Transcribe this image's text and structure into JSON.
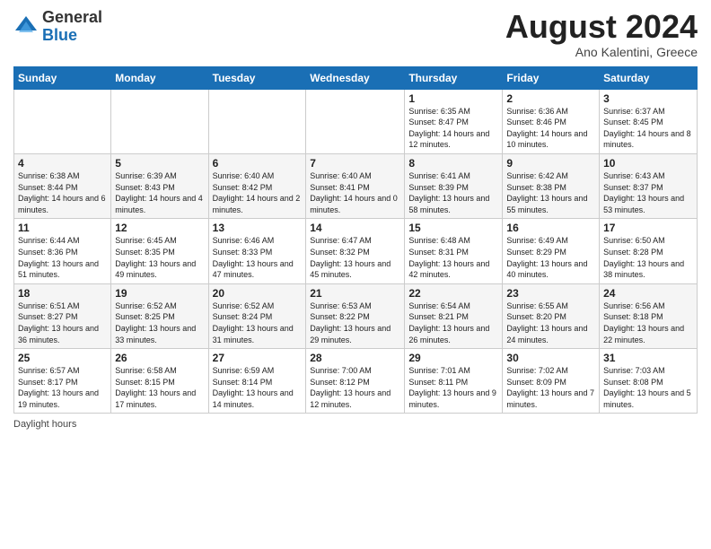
{
  "header": {
    "logo_general": "General",
    "logo_blue": "Blue",
    "title": "August 2024",
    "location": "Ano Kalentini, Greece"
  },
  "calendar": {
    "days_of_week": [
      "Sunday",
      "Monday",
      "Tuesday",
      "Wednesday",
      "Thursday",
      "Friday",
      "Saturday"
    ],
    "weeks": [
      [
        {
          "day": "",
          "info": ""
        },
        {
          "day": "",
          "info": ""
        },
        {
          "day": "",
          "info": ""
        },
        {
          "day": "",
          "info": ""
        },
        {
          "day": "1",
          "info": "Sunrise: 6:35 AM\nSunset: 8:47 PM\nDaylight: 14 hours\nand 12 minutes."
        },
        {
          "day": "2",
          "info": "Sunrise: 6:36 AM\nSunset: 8:46 PM\nDaylight: 14 hours\nand 10 minutes."
        },
        {
          "day": "3",
          "info": "Sunrise: 6:37 AM\nSunset: 8:45 PM\nDaylight: 14 hours\nand 8 minutes."
        }
      ],
      [
        {
          "day": "4",
          "info": "Sunrise: 6:38 AM\nSunset: 8:44 PM\nDaylight: 14 hours\nand 6 minutes."
        },
        {
          "day": "5",
          "info": "Sunrise: 6:39 AM\nSunset: 8:43 PM\nDaylight: 14 hours\nand 4 minutes."
        },
        {
          "day": "6",
          "info": "Sunrise: 6:40 AM\nSunset: 8:42 PM\nDaylight: 14 hours\nand 2 minutes."
        },
        {
          "day": "7",
          "info": "Sunrise: 6:40 AM\nSunset: 8:41 PM\nDaylight: 14 hours\nand 0 minutes."
        },
        {
          "day": "8",
          "info": "Sunrise: 6:41 AM\nSunset: 8:39 PM\nDaylight: 13 hours\nand 58 minutes."
        },
        {
          "day": "9",
          "info": "Sunrise: 6:42 AM\nSunset: 8:38 PM\nDaylight: 13 hours\nand 55 minutes."
        },
        {
          "day": "10",
          "info": "Sunrise: 6:43 AM\nSunset: 8:37 PM\nDaylight: 13 hours\nand 53 minutes."
        }
      ],
      [
        {
          "day": "11",
          "info": "Sunrise: 6:44 AM\nSunset: 8:36 PM\nDaylight: 13 hours\nand 51 minutes."
        },
        {
          "day": "12",
          "info": "Sunrise: 6:45 AM\nSunset: 8:35 PM\nDaylight: 13 hours\nand 49 minutes."
        },
        {
          "day": "13",
          "info": "Sunrise: 6:46 AM\nSunset: 8:33 PM\nDaylight: 13 hours\nand 47 minutes."
        },
        {
          "day": "14",
          "info": "Sunrise: 6:47 AM\nSunset: 8:32 PM\nDaylight: 13 hours\nand 45 minutes."
        },
        {
          "day": "15",
          "info": "Sunrise: 6:48 AM\nSunset: 8:31 PM\nDaylight: 13 hours\nand 42 minutes."
        },
        {
          "day": "16",
          "info": "Sunrise: 6:49 AM\nSunset: 8:29 PM\nDaylight: 13 hours\nand 40 minutes."
        },
        {
          "day": "17",
          "info": "Sunrise: 6:50 AM\nSunset: 8:28 PM\nDaylight: 13 hours\nand 38 minutes."
        }
      ],
      [
        {
          "day": "18",
          "info": "Sunrise: 6:51 AM\nSunset: 8:27 PM\nDaylight: 13 hours\nand 36 minutes."
        },
        {
          "day": "19",
          "info": "Sunrise: 6:52 AM\nSunset: 8:25 PM\nDaylight: 13 hours\nand 33 minutes."
        },
        {
          "day": "20",
          "info": "Sunrise: 6:52 AM\nSunset: 8:24 PM\nDaylight: 13 hours\nand 31 minutes."
        },
        {
          "day": "21",
          "info": "Sunrise: 6:53 AM\nSunset: 8:22 PM\nDaylight: 13 hours\nand 29 minutes."
        },
        {
          "day": "22",
          "info": "Sunrise: 6:54 AM\nSunset: 8:21 PM\nDaylight: 13 hours\nand 26 minutes."
        },
        {
          "day": "23",
          "info": "Sunrise: 6:55 AM\nSunset: 8:20 PM\nDaylight: 13 hours\nand 24 minutes."
        },
        {
          "day": "24",
          "info": "Sunrise: 6:56 AM\nSunset: 8:18 PM\nDaylight: 13 hours\nand 22 minutes."
        }
      ],
      [
        {
          "day": "25",
          "info": "Sunrise: 6:57 AM\nSunset: 8:17 PM\nDaylight: 13 hours\nand 19 minutes."
        },
        {
          "day": "26",
          "info": "Sunrise: 6:58 AM\nSunset: 8:15 PM\nDaylight: 13 hours\nand 17 minutes."
        },
        {
          "day": "27",
          "info": "Sunrise: 6:59 AM\nSunset: 8:14 PM\nDaylight: 13 hours\nand 14 minutes."
        },
        {
          "day": "28",
          "info": "Sunrise: 7:00 AM\nSunset: 8:12 PM\nDaylight: 13 hours\nand 12 minutes."
        },
        {
          "day": "29",
          "info": "Sunrise: 7:01 AM\nSunset: 8:11 PM\nDaylight: 13 hours\nand 9 minutes."
        },
        {
          "day": "30",
          "info": "Sunrise: 7:02 AM\nSunset: 8:09 PM\nDaylight: 13 hours\nand 7 minutes."
        },
        {
          "day": "31",
          "info": "Sunrise: 7:03 AM\nSunset: 8:08 PM\nDaylight: 13 hours\nand 5 minutes."
        }
      ]
    ]
  },
  "footer": {
    "daylight_label": "Daylight hours"
  }
}
